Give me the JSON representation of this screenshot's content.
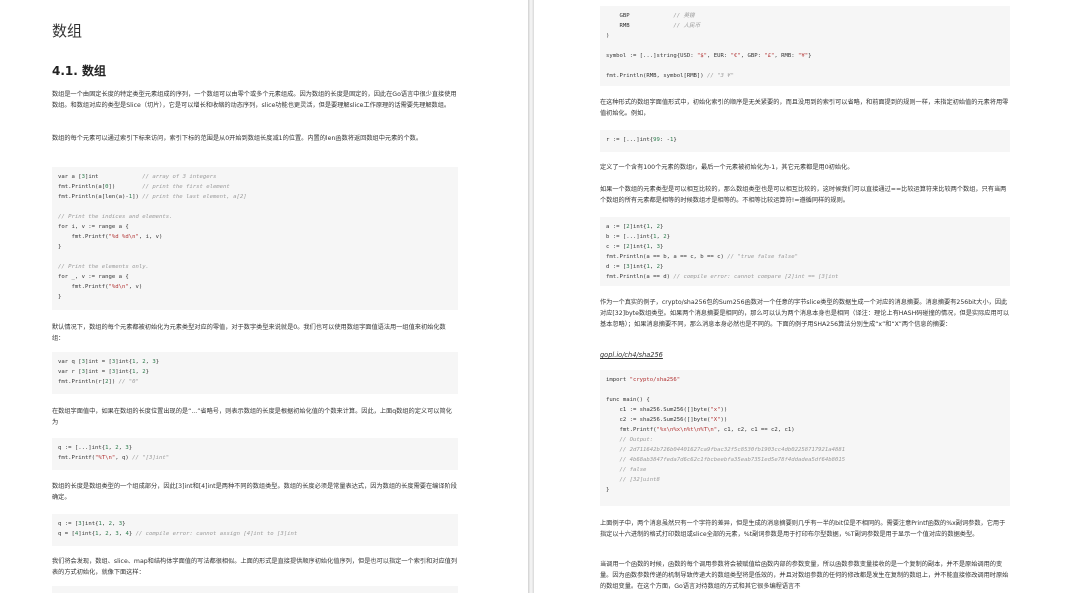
{
  "left_page": {
    "chapter_title": "数组",
    "section_title": "4.1. 数组",
    "para1": "数组是一个由固定长度的特定类型元素组成的序列，一个数组可以由零个或多个元素组成。因为数组的长度是固定的，因此在Go语言中很少直接使用数组。和数组对应的类型是Slice（切片），它是可以增长和收缩的动态序列，slice功能也更灵活，但是要理解slice工作原理的话需要先理解数组。",
    "para2": "数组的每个元素可以通过索引下标来访问，索引下标的范围是从0开始到数组长度减1的位置。内置的len函数将返回数组中元素的个数。",
    "code1": [
      "var a [3]int             // array of 3 integers",
      "fmt.Println(a[0])        // print the first element",
      "fmt.Println(a[len(a)-1]) // print the last element, a[2]",
      "",
      "// Print the indices and elements.",
      "for i, v := range a {",
      "    fmt.Printf(\"%d %d\\n\", i, v)",
      "}",
      "",
      "// Print the elements only.",
      "for _, v := range a {",
      "    fmt.Printf(\"%d\\n\", v)",
      "}"
    ],
    "para3": "默认情况下，数组的每个元素都被初始化为元素类型对应的零值，对于数字类型来说就是0。我们也可以使用数组字面值语法用一组值来初始化数组：",
    "code2": [
      "var q [3]int = [3]int{1, 2, 3}",
      "var r [3]int = [3]int{1, 2}",
      "fmt.Println(r[2]) // \"0\""
    ],
    "para4": "在数组字面值中，如果在数组的长度位置出现的是“...”省略号，则表示数组的长度是根据初始化值的个数来计算。因此，上面q数组的定义可以简化为",
    "code3": [
      "q := [...]int{1, 2, 3}",
      "fmt.Printf(\"%T\\n\", q) // \"[3]int\""
    ],
    "para5": "数组的长度是数组类型的一个组成部分，因此[3]int和[4]int是两种不同的数组类型。数组的长度必须是常量表达式，因为数组的长度需要在编译阶段确定。",
    "code4": [
      "q := [3]int{1, 2, 3}",
      "q = [4]int{1, 2, 3, 4} // compile error: cannot assign [4]int to [3]int"
    ],
    "para6": "我们将会发现，数组、slice、map和结构体字面值的写法都很相似。上面的形式是直接提供顺序初始化值序列，但是也可以指定一个索引和对应值列表的方式初始化，就像下面这样："
  },
  "right_page": {
    "code1": [
      "    GBP             // 英镑",
      "    RMB             // 人民币",
      ")",
      "",
      "symbol := [...]string{USD: \"$\", EUR: \"€\", GBP: \"£\", RMB: \"¥\"}",
      "",
      "fmt.Println(RMB, symbol[RMB]) // \"3 ¥\""
    ],
    "para1": "在这种形式的数组字面值形式中，初始化索引的顺序是无关紧要的，而且没用到的索引可以省略，和前面提到的规则一样，未指定初始值的元素将用零值初始化。例如，",
    "code2": [
      "r := [...]int{99: -1}"
    ],
    "para2": "定义了一个含有100个元素的数组r，最后一个元素被初始化为-1，其它元素都是用0初始化。",
    "para3": "如果一个数组的元素类型是可以相互比较的，那么数组类型也是可以相互比较的，这时候我们可以直接通过==比较运算符来比较两个数组，只有当两个数组的所有元素都是相等的时候数组才是相等的。不相等比较运算符!=遵循同样的规则。",
    "code3": [
      "a := [2]int{1, 2}",
      "b := [...]int{1, 2}",
      "c := [2]int{1, 3}",
      "fmt.Println(a == b, a == c, b == c) // \"true false false\"",
      "d := [3]int{1, 2}",
      "fmt.Println(a == d) // compile error: cannot compare [2]int == [3]int"
    ],
    "para4": "作为一个真实的例子，crypto/sha256包的Sum256函数对一个任意的字节slice类型的数据生成一个对应的消息摘要。消息摘要有256bit大小，因此对应[32]byte数组类型。如果两个消息摘要是相同的，那么可以认为两个消息本身也是相同（译注：理论上有HASH码碰撞的情况，但是实际应用可以基本忽略）；如果消息摘要不同，那么消息本身必然也是不同的。下面的例子用SHA256算法分别生成“x”和“X”两个信息的摘要：",
    "link": "gopl.io/ch4/sha256",
    "code4": [
      "import \"crypto/sha256\"",
      "",
      "func main() {",
      "    c1 := sha256.Sum256([]byte(\"x\"))",
      "    c2 := sha256.Sum256([]byte(\"X\"))",
      "    fmt.Printf(\"%x\\n%x\\n%t\\n%T\\n\", c1, c2, c1 == c2, c1)",
      "    // Output:",
      "    // 2d711642b726b04401627ca9fbac32f5c8530fb1903cc4db02258717921a4881",
      "    // 4b68ab3847feda7d6c62c1fbcbeebfa35eab7351ed5e78f4ddadea5df64b8015",
      "    // false",
      "    // [32]uint8",
      "}"
    ],
    "para5": "上面例子中，两个消息虽然只有一个字符的差异，但是生成的消息摘要则几乎有一半的bit位是不相同的。需要注意Printf函数的%x副词参数，它用于指定以十六进制的格式打印数组或slice全部的元素，%t副词参数是用于打印布尔型数据，%T副词参数是用于显示一个值对应的数据类型。",
    "para6": "当调用一个函数的时候，函数的每个调用参数将会被赋值给函数内部的参数变量，所以函数参数变量接收的是一个复制的副本，并不是原始调用的变量。因为函数参数传递的机制导致传递大的数组类型将是低效的，并且对数组参数的任何的修改都是发生在复制的数组上，并不能直接修改调用时原始的数组变量。在这个方面，Go语言对待数组的方式和其它很多编程语言不"
  }
}
